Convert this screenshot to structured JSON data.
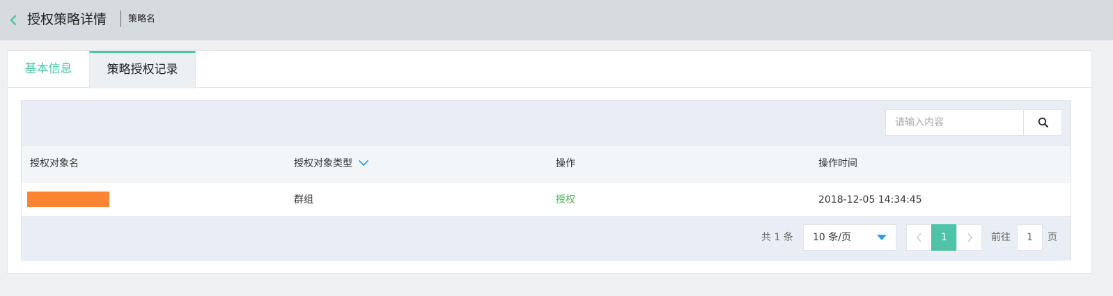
{
  "header": {
    "title": "授权策略详情",
    "subtitle": "策略名",
    "back_icon": "chevron-left-icon",
    "accent_color": "#4fc3a8"
  },
  "tabs": [
    {
      "label": "基本信息",
      "active": false
    },
    {
      "label": "策略授权记录",
      "active": true
    }
  ],
  "search": {
    "placeholder": "请输入内容",
    "value": "",
    "icon": "search-icon"
  },
  "table": {
    "columns": [
      "授权对象名",
      "授权对象类型",
      "操作",
      "操作时间"
    ],
    "filter_icon": "chevron-down-icon",
    "rows": [
      {
        "name": "",
        "name_redacted": true,
        "type": "群组",
        "action": "授权",
        "time": "2018-12-05 14:34:45"
      }
    ]
  },
  "pagination": {
    "total_text": "共 1 条",
    "page_size": "10 条/页",
    "current_page": "1",
    "goto_label": "前往",
    "goto_value": "1",
    "goto_suffix": "页"
  }
}
